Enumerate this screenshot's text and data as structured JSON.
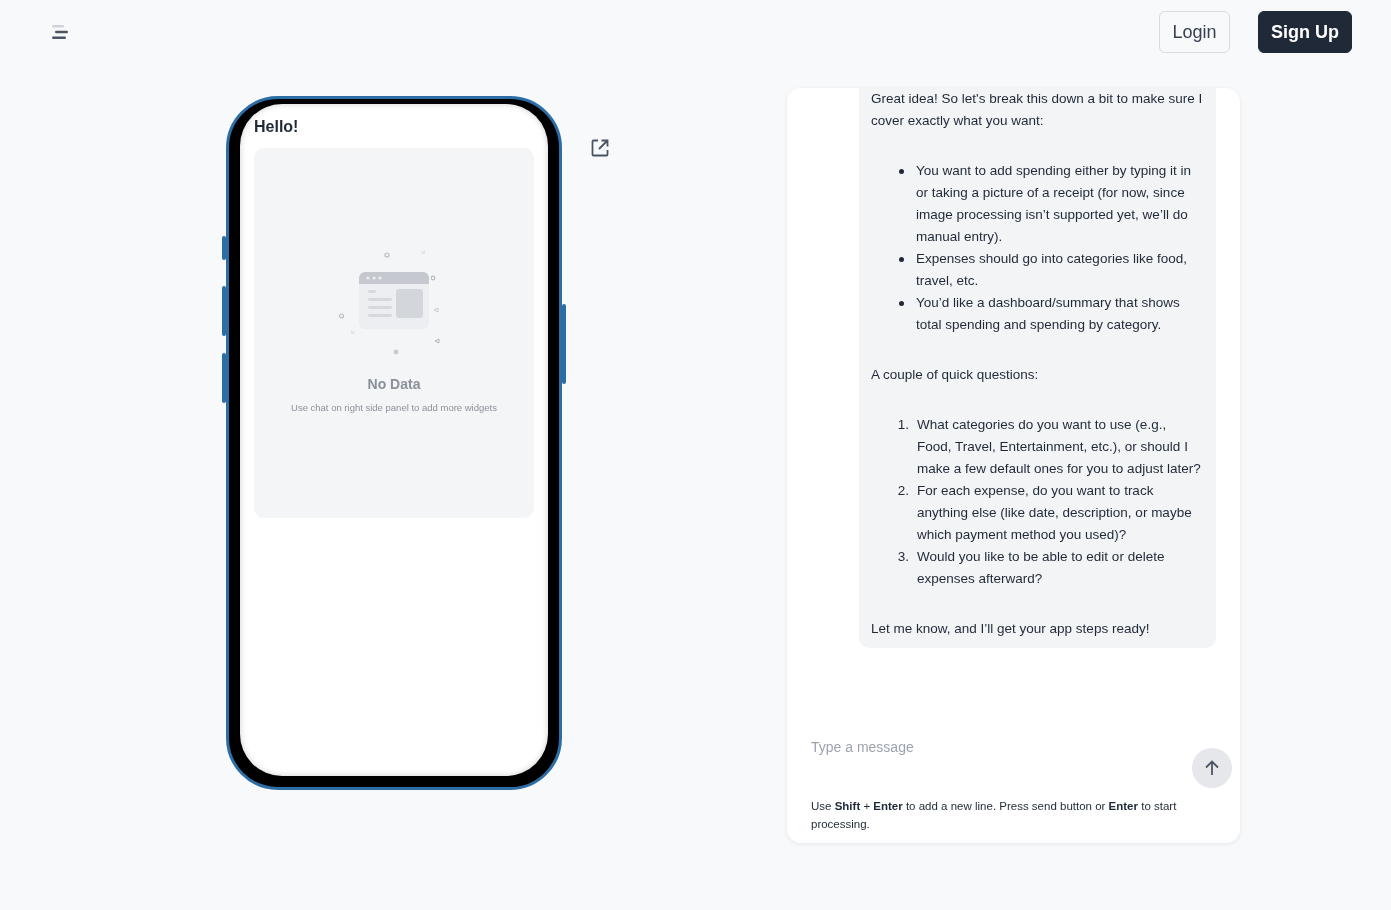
{
  "header": {
    "buttons": [
      {
        "label": "Login",
        "kind": "outline"
      },
      {
        "label": "Sign Up",
        "kind": "primary"
      }
    ]
  },
  "preview": {
    "title": "Hello!",
    "empty_title": "No Data",
    "empty_hint": "Use chat on right side panel to add more widgets"
  },
  "chat": {
    "messages": [
      {
        "blocks": [
          {
            "kind": "paragraph",
            "text": "Great idea! So let's break this down a bit to make sure I cover exactly what you want:"
          },
          {
            "kind": "bullets",
            "items": [
              "You want to add spending either by typing it in or taking a picture of a receipt (for now, since image processing isn’t supported yet, we’ll do manual entry).",
              "Expenses should go into categories like food, travel, etc.",
              "You’d like a dashboard/summary that shows total spending and spending by category."
            ]
          },
          {
            "kind": "paragraph",
            "text": "A couple of quick questions:"
          },
          {
            "kind": "numbered",
            "items": [
              {
                "number": "1.",
                "text": "What categories do you want to use (e.g., Food, Travel, Entertainment, etc.), or should I make a few default ones for you to adjust later?"
              },
              {
                "number": "2.",
                "text": "For each expense, do you want to track anything else (like date, description, or maybe which payment method you used)?"
              },
              {
                "number": "3.",
                "text": "Would you like to be able to edit or delete expenses afterward?"
              }
            ]
          },
          {
            "kind": "paragraph",
            "text": "Let me know, and I’ll get your app steps ready!"
          }
        ]
      }
    ],
    "input": {
      "placeholder": "Type a message"
    },
    "hint": "Use **Shift** + **Enter** to add a new line. Press send button or **Enter** to start processing."
  }
}
